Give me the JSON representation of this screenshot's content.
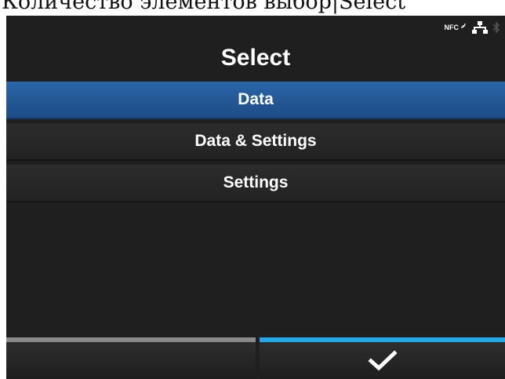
{
  "caption": "Количество элементов выбор|Select",
  "status": {
    "nfc_label": "NFC",
    "icons": [
      "nfc-icon",
      "network-icon",
      "bluetooth-icon"
    ]
  },
  "title": "Select",
  "menu": {
    "items": [
      {
        "label": "Data",
        "selected": true
      },
      {
        "label": "Data & Settings",
        "selected": false
      },
      {
        "label": "Settings",
        "selected": false
      }
    ]
  },
  "softkeys": {
    "left": {
      "label": ""
    },
    "right": {
      "icon": "checkmark-icon"
    }
  },
  "colors": {
    "background": "#1f1f1f",
    "selected_row": "#245a98",
    "left_key_bar": "#8a8a8a",
    "right_key_bar": "#20a8e8",
    "text": "#ffffff"
  }
}
